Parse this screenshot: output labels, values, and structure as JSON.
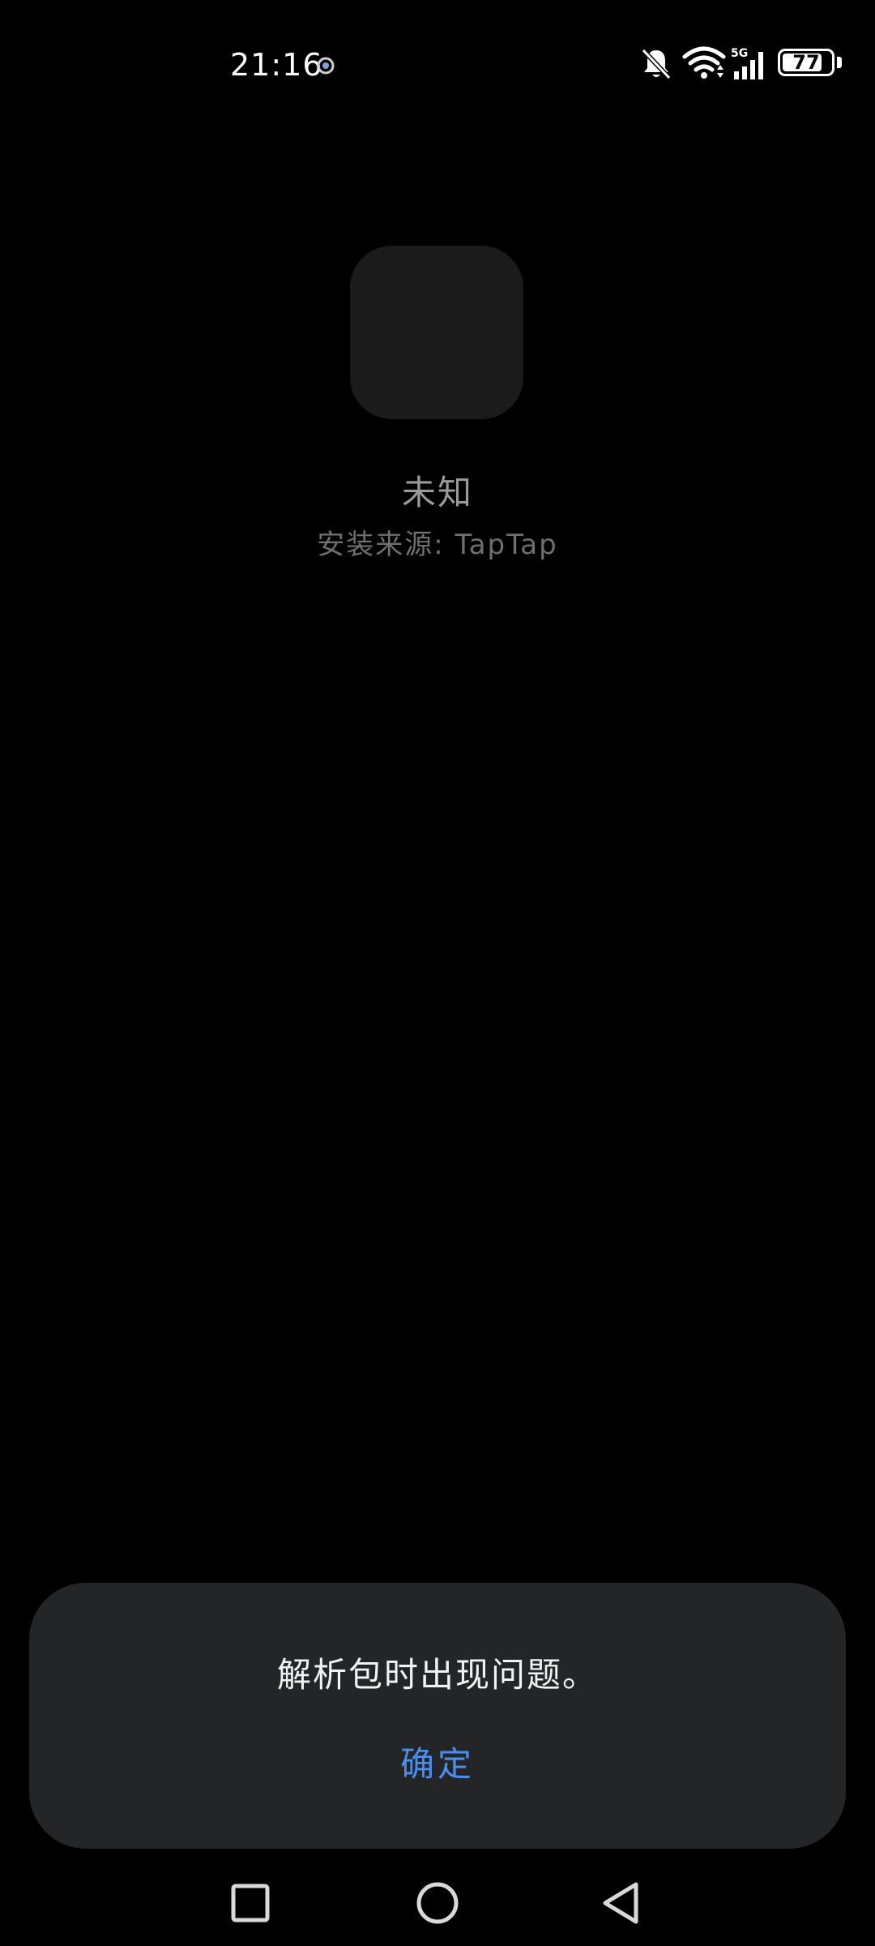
{
  "status_bar": {
    "time": "21:16",
    "battery_level": "77",
    "network": "5G",
    "icons": [
      "sync-icon",
      "bell-muted-icon",
      "wifi-icon",
      "signal-icon",
      "battery-icon"
    ]
  },
  "installer": {
    "app_name": "未知",
    "install_source": "安装来源: TapTap"
  },
  "dialog": {
    "message": "解析包时出现问题。",
    "confirm_label": "确定"
  },
  "nav_bar": {
    "icons": [
      "recents-square-icon",
      "home-circle-icon",
      "back-triangle-icon"
    ]
  },
  "colors": {
    "background": "#000000",
    "dialog_bg": "#242527",
    "accent": "#4a8ef0",
    "icon_placeholder": "#1b1b1b"
  }
}
